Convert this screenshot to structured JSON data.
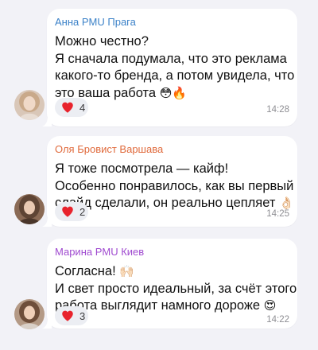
{
  "messages": [
    {
      "sender": "Анна PMU Прага",
      "sender_color": "#3c82c8",
      "lines": [
        "Можно честно?",
        "Я сначала подумала, что это реклама",
        "какого-то бренда, а потом увидела, что",
        "это ваша работа"
      ],
      "trailing_emoji": "😳🔥",
      "reaction_emoji": "heart-icon",
      "reaction_count": "4",
      "time": "14:28"
    },
    {
      "sender": "Оля Бровист Варшава",
      "sender_color": "#e06a3c",
      "lines": [
        "Я тоже посмотрела — кайф!",
        "Особенно понравилось, как вы первый",
        "слайд сделали, он реально цепляет"
      ],
      "trailing_emoji": "👌🏻",
      "reaction_emoji": "heart-icon",
      "reaction_count": "2",
      "time": "14:25"
    },
    {
      "sender": "Марина PMU Киев",
      "sender_color": "#a04bd0",
      "lines": [
        "Согласна!",
        "И свет просто идеальный, за счёт этого",
        "работа выглядит намного дороже"
      ],
      "first_line_emoji": "🙌🏻",
      "trailing_emoji": "😍",
      "reaction_emoji": "heart-icon",
      "reaction_count": "3",
      "time": "14:22"
    }
  ],
  "colors": {
    "background": "#f2f2f7",
    "bubble": "#ffffff",
    "reaction_bg": "#eceef3",
    "heart": "#e8232c"
  }
}
